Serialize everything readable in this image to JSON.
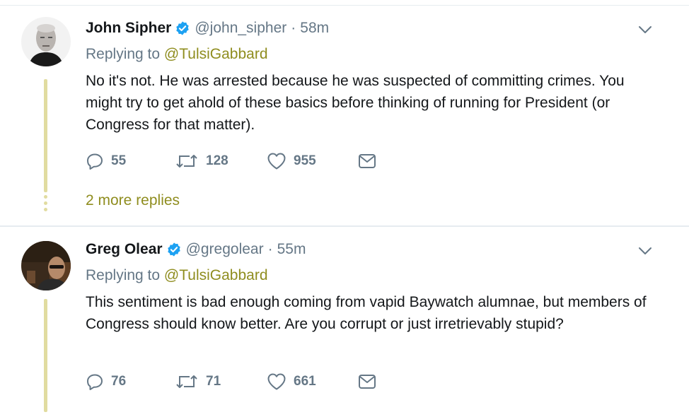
{
  "tweets": [
    {
      "name": "John Sipher",
      "handle": "@john_sipher",
      "dot": "·",
      "time": "58m",
      "reply_prefix": "Replying to",
      "reply_mention": "@TulsiGabbard",
      "text": "No it's not. He was arrested because he was suspected of committing crimes. You might try to get ahold of these basics before thinking of running for President (or Congress for that matter).",
      "replies": "55",
      "retweets": "128",
      "likes": "955",
      "more_replies": "2 more replies"
    },
    {
      "name": "Greg Olear",
      "handle": "@gregolear",
      "dot": "·",
      "time": "55m",
      "reply_prefix": "Replying to",
      "reply_mention": "@TulsiGabbard",
      "text": "This sentiment is bad enough coming from vapid Baywatch alumnae, but members of Congress should know better. Are you corrupt or just irretrievably stupid?",
      "replies": "76",
      "retweets": "71",
      "likes": "661"
    }
  ],
  "colors": {
    "link_accent": "#8f8d1f",
    "muted": "#657786",
    "verified": "#1da1f2",
    "thread_line": "#e1dca0"
  },
  "icons": [
    "verified-icon",
    "chevron-down-icon",
    "reply-icon",
    "retweet-icon",
    "like-icon",
    "message-icon"
  ]
}
